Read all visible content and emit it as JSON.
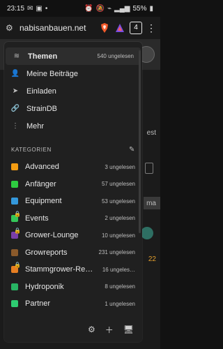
{
  "status_bar": {
    "time": "23:15",
    "battery": "55%"
  },
  "browser": {
    "url": "nabisanbauen.net",
    "tabs_count": "4"
  },
  "drawer": {
    "nav": [
      {
        "label": "Themen",
        "meta": "540 ungelesen",
        "icon": "layers-icon",
        "active": true
      },
      {
        "label": "Meine Beiträge",
        "meta": "",
        "icon": "user-icon"
      },
      {
        "label": "Einladen",
        "meta": "",
        "icon": "send-icon"
      },
      {
        "label": "StrainDB",
        "meta": "",
        "icon": "link-icon"
      },
      {
        "label": "Mehr",
        "meta": "",
        "icon": "more-vert-icon"
      }
    ],
    "categories_header": "KATEGORIEN",
    "categories": [
      {
        "label": "Advanced",
        "meta": "3 ungelesen",
        "color": "#F39C12",
        "locked": false
      },
      {
        "label": "Anfänger",
        "meta": "57 ungelesen",
        "color": "#2ECC40",
        "locked": false
      },
      {
        "label": "Equipment",
        "meta": "53 ungelesen",
        "color": "#3498DB",
        "locked": false
      },
      {
        "label": "Events",
        "meta": "2 ungelesen",
        "color": "#34C759",
        "locked": true
      },
      {
        "label": "Grower-Lounge",
        "meta": "10 ungelesen",
        "color": "#7A3FA8",
        "locked": true
      },
      {
        "label": "Growreports",
        "meta": "231 ungelesen",
        "color": "#8B5A2B",
        "locked": false
      },
      {
        "label": "Stammgrower-Repor…",
        "meta": "16 ungeles…",
        "color": "#E67E22",
        "locked": true
      },
      {
        "label": "Hydroponik",
        "meta": "8 ungelesen",
        "color": "#28B463",
        "locked": false
      },
      {
        "label": "Partner",
        "meta": "1 ungelesen",
        "color": "#2ECC71",
        "locked": false
      }
    ]
  },
  "background": {
    "snips": [
      "est",
      "ma",
      "22"
    ]
  }
}
